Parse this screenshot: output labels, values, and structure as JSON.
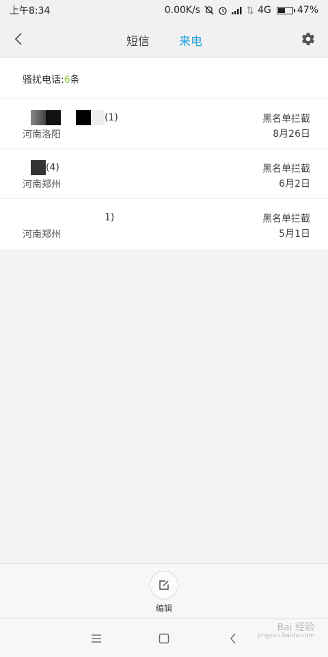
{
  "status_bar": {
    "time": "上午8:34",
    "speed": "0.00K/s",
    "network": "4G",
    "battery": "47%",
    "battery_level": 0.47,
    "icons": [
      "mute-icon",
      "alarm-icon",
      "signal-icon",
      "data-icon",
      "battery-icon"
    ]
  },
  "header": {
    "back_icon": "back-chevron-icon",
    "tabs": [
      {
        "label": "短信",
        "active": false
      },
      {
        "label": "来电",
        "active": true
      }
    ],
    "settings_icon": "gear-icon",
    "accent_color": "#1e9fe0"
  },
  "summary": {
    "prefix": "骚扰电话:",
    "count": "6",
    "suffix": "条",
    "count_color": "#8cc43a"
  },
  "calls": [
    {
      "name_suffix": "(1)",
      "location": "河南洛阳",
      "tag": "黑名单拦截",
      "date": "8月26日"
    },
    {
      "name_suffix": "(4)",
      "location": "河南郑州",
      "tag": "黑名单拦截",
      "date": "6月2日"
    },
    {
      "name_suffix": "1)",
      "location": "河南郑州",
      "tag": "黑名单拦截",
      "date": "5月1日"
    }
  ],
  "bottom": {
    "edit_label": "编辑",
    "edit_icon": "edit-icon"
  },
  "nav": {
    "icons": [
      "menu-icon",
      "home-icon",
      "back-icon"
    ],
    "watermark": "Bai 经验",
    "watermark_url": "jingyan.baidu.com"
  }
}
